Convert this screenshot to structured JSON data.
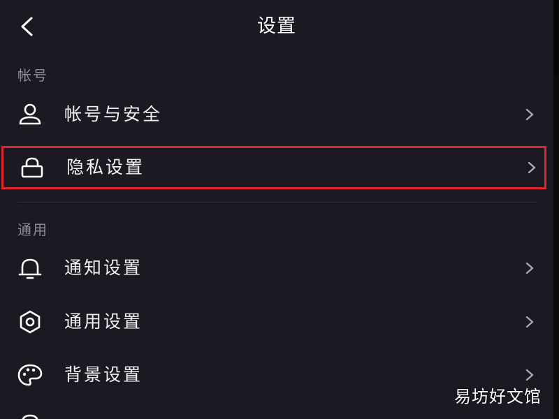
{
  "header": {
    "title": "设置",
    "back_icon": "chevron-left-icon"
  },
  "sections": [
    {
      "title": "帐号",
      "items": [
        {
          "label": "帐号与安全",
          "icon": "user-icon"
        },
        {
          "label": "隐私设置",
          "icon": "lock-icon",
          "highlighted": true
        }
      ]
    },
    {
      "title": "通用",
      "items": [
        {
          "label": "通知设置",
          "icon": "bell-icon"
        },
        {
          "label": "通用设置",
          "icon": "gear-icon"
        },
        {
          "label": "背景设置",
          "icon": "palette-icon"
        }
      ]
    }
  ],
  "watermark": "易坊好文馆",
  "colors": {
    "background": "#1b1a22",
    "highlight_border": "#e0262b",
    "section_title": "#8d8c93",
    "text": "#f2f2f4"
  }
}
